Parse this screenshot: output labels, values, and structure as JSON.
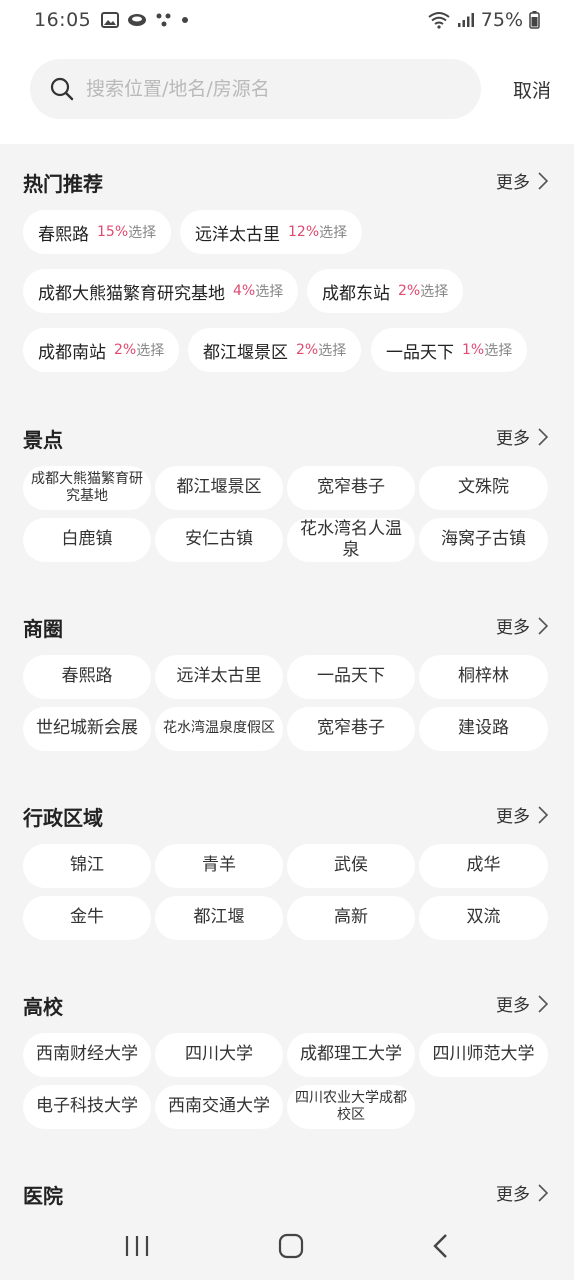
{
  "status": {
    "time": "16:05",
    "battery": "75%"
  },
  "search": {
    "placeholder": "搜索位置/地名/房源名",
    "cancel": "取消"
  },
  "more_label": "更多",
  "hot": {
    "title": "热门推荐",
    "items": [
      {
        "name": "春熙路",
        "pct": "15%",
        "suffix": "选择"
      },
      {
        "name": "远洋太古里",
        "pct": "12%",
        "suffix": "选择"
      },
      {
        "name": "成都大熊猫繁育研究基地",
        "pct": "4%",
        "suffix": "选择"
      },
      {
        "name": "成都东站",
        "pct": "2%",
        "suffix": "选择"
      },
      {
        "name": "成都南站",
        "pct": "2%",
        "suffix": "选择"
      },
      {
        "name": "都江堰景区",
        "pct": "2%",
        "suffix": "选择"
      },
      {
        "name": "一品天下",
        "pct": "1%",
        "suffix": "选择"
      }
    ]
  },
  "scenic": {
    "title": "景点",
    "items": [
      "成都大熊猫繁育研究基地",
      "都江堰景区",
      "宽窄巷子",
      "文殊院",
      "白鹿镇",
      "安仁古镇",
      "花水湾名人温泉",
      "海窝子古镇"
    ]
  },
  "business": {
    "title": "商圈",
    "items": [
      "春熙路",
      "远洋太古里",
      "一品天下",
      "桐梓林",
      "世纪城新会展",
      "花水湾温泉度假区",
      "宽窄巷子",
      "建设路"
    ]
  },
  "district": {
    "title": "行政区域",
    "items": [
      "锦江",
      "青羊",
      "武侯",
      "成华",
      "金牛",
      "都江堰",
      "高新",
      "双流"
    ]
  },
  "college": {
    "title": "高校",
    "items": [
      "西南财经大学",
      "四川大学",
      "成都理工大学",
      "四川师范大学",
      "电子科技大学",
      "西南交通大学",
      "四川农业大学成都校区"
    ]
  },
  "hospital": {
    "title": "医院"
  }
}
